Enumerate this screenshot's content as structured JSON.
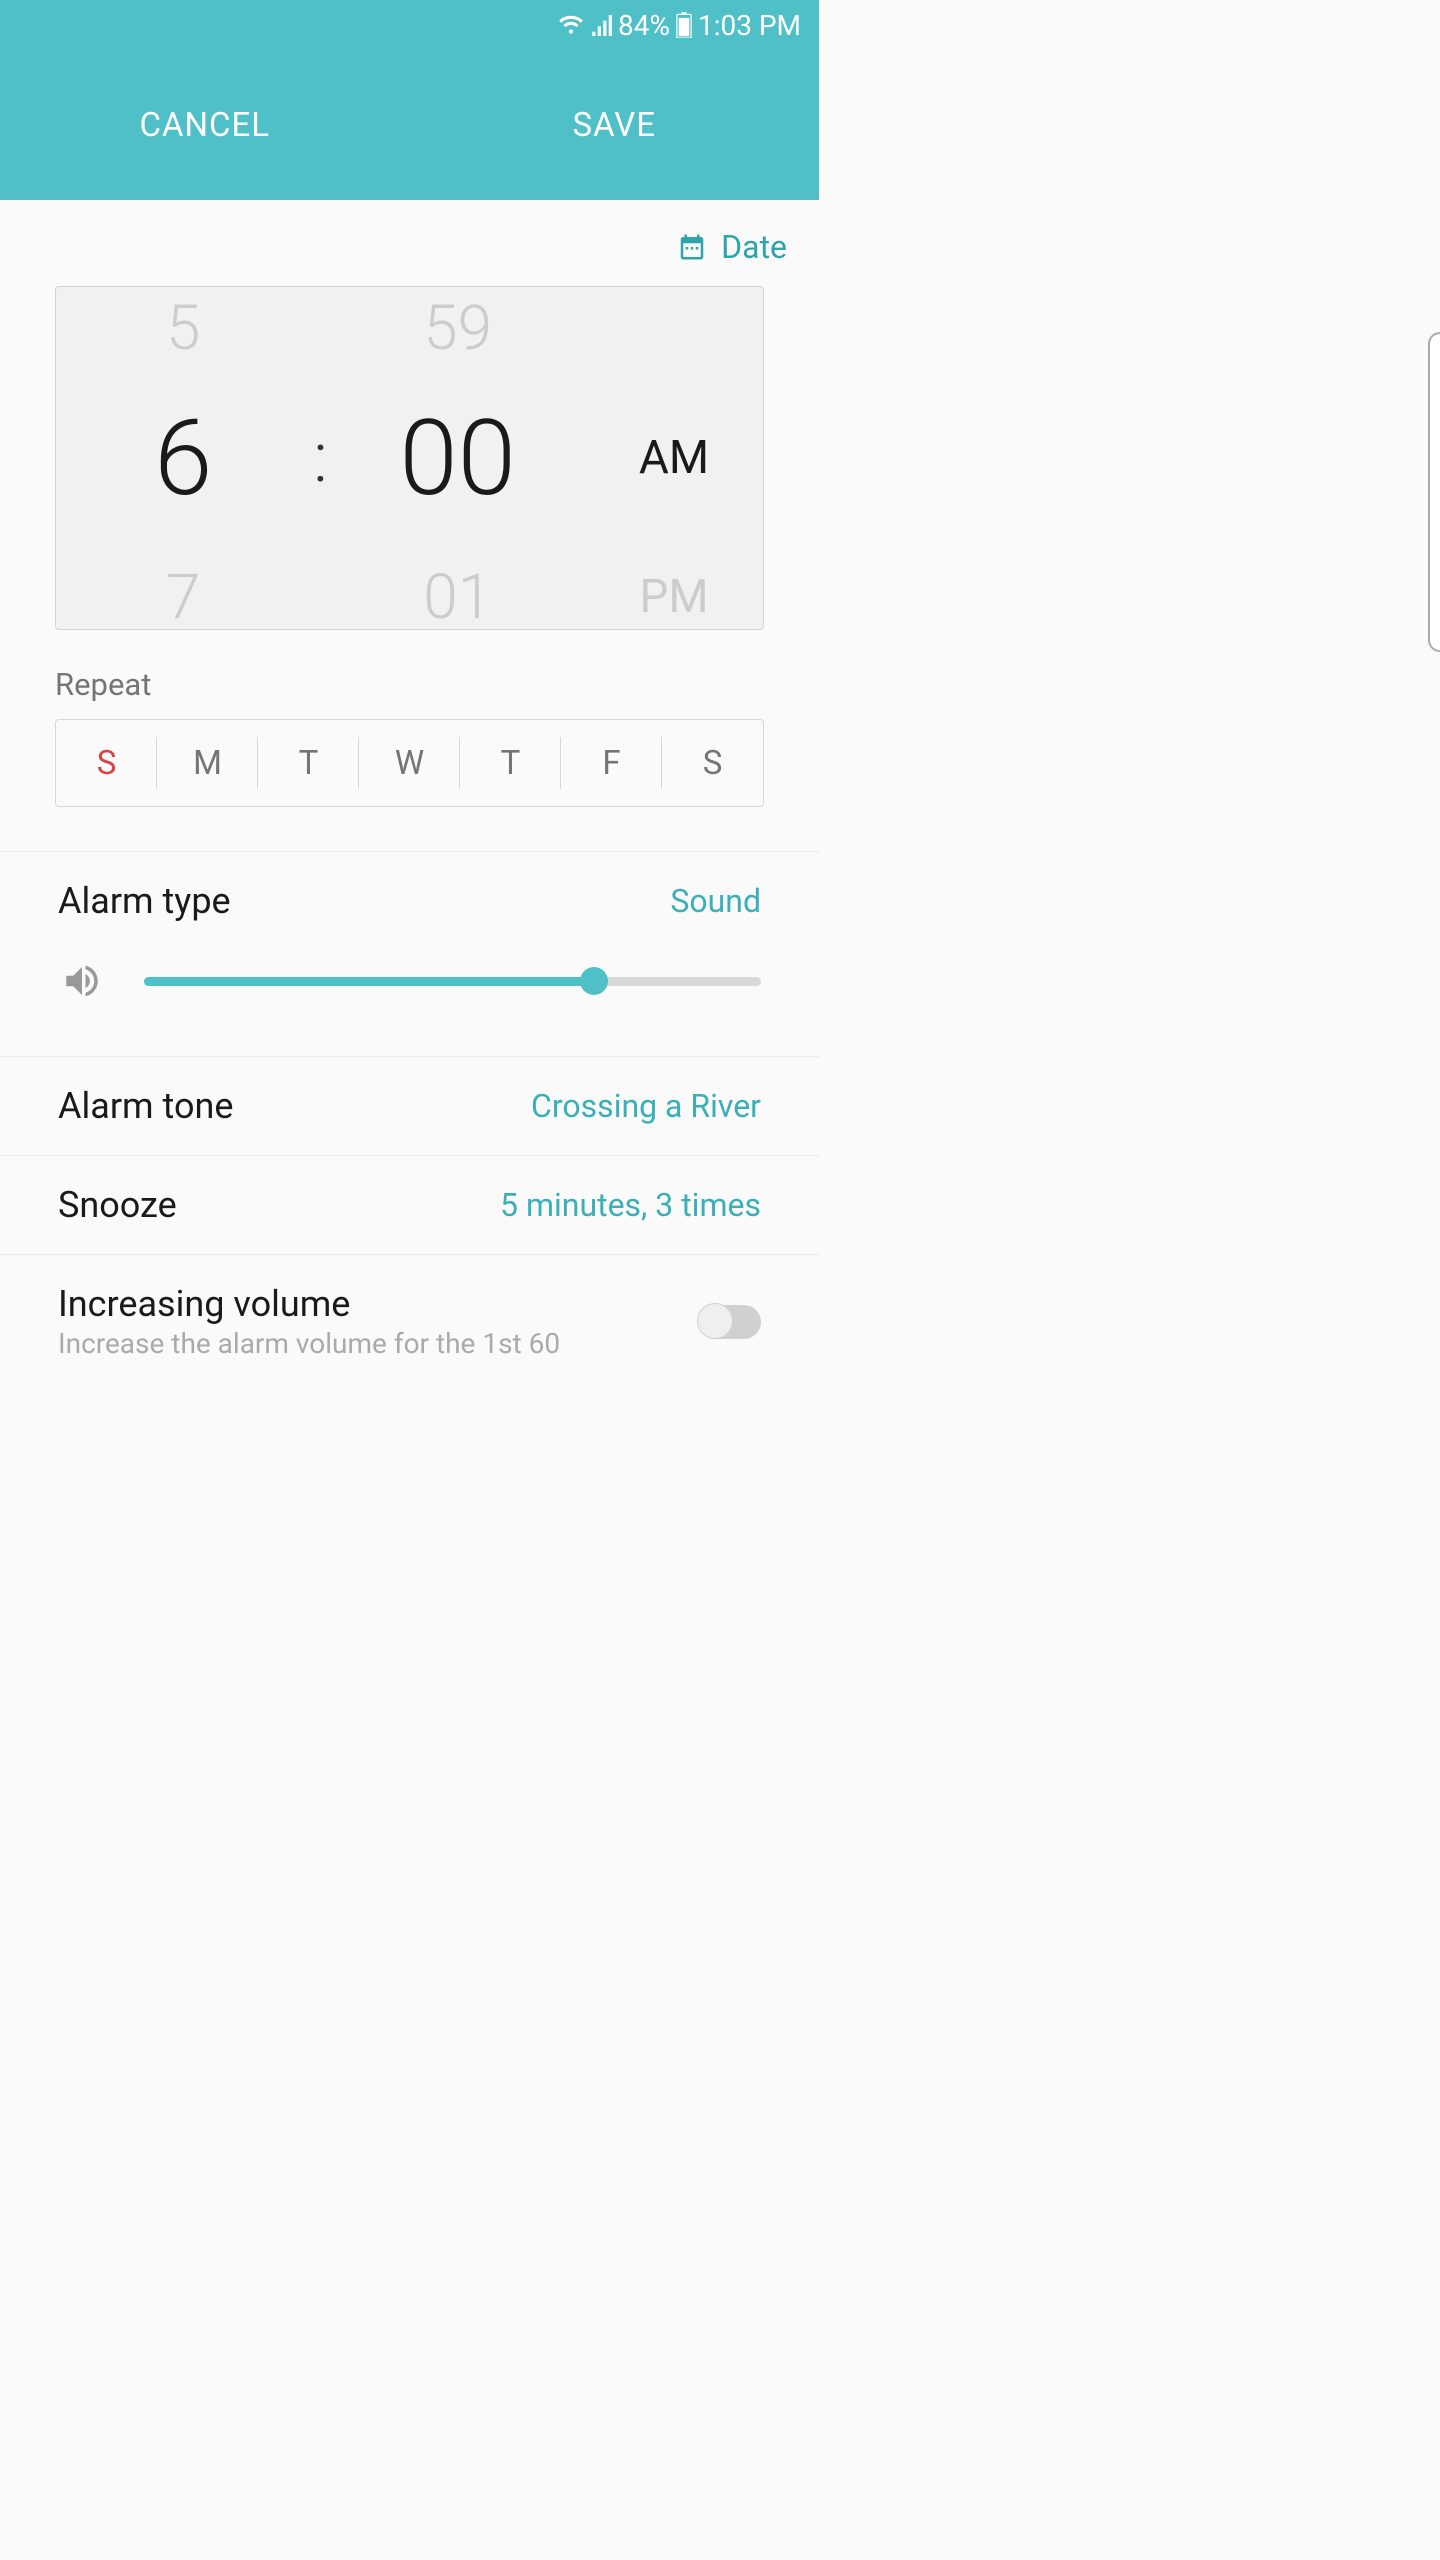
{
  "status_bar": {
    "battery": "84%",
    "time": "1:03 PM"
  },
  "actions": {
    "cancel": "CANCEL",
    "save": "SAVE"
  },
  "date_button": "Date",
  "time_picker": {
    "hour_prev": "5",
    "hour": "6",
    "hour_next": "7",
    "colon": ":",
    "minute_prev": "59",
    "minute": "00",
    "minute_next": "01",
    "ampm": "AM",
    "ampm_alt": "PM"
  },
  "repeat": {
    "label": "Repeat",
    "days": [
      "S",
      "M",
      "T",
      "W",
      "T",
      "F",
      "S"
    ]
  },
  "settings": {
    "alarm_type": {
      "label": "Alarm type",
      "value": "Sound",
      "volume_percent": 73
    },
    "alarm_tone": {
      "label": "Alarm tone",
      "value": "Crossing a River"
    },
    "snooze": {
      "label": "Snooze",
      "value": "5 minutes, 3 times"
    },
    "increasing_volume": {
      "label": "Increasing volume",
      "subtext": "Increase the alarm volume for the 1st 60"
    }
  }
}
